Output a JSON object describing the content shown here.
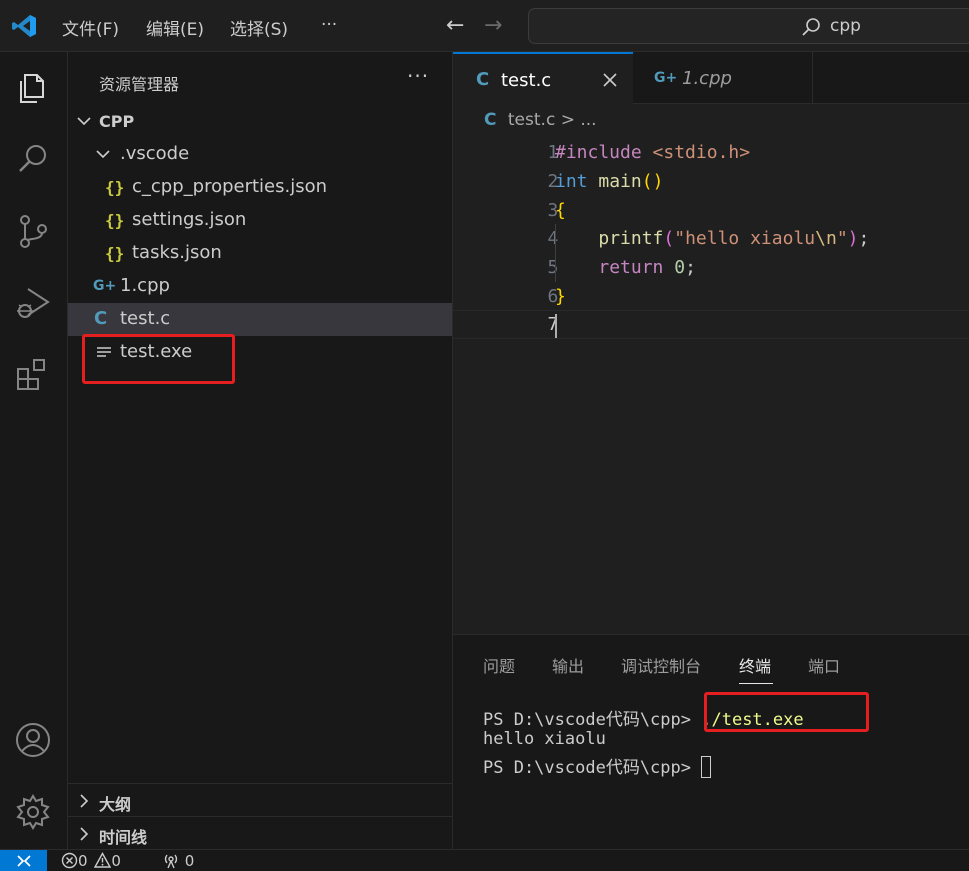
{
  "menu": {
    "file": "文件(F)",
    "edit": "编辑(E)",
    "select": "选择(S)",
    "more": "···"
  },
  "command_center": {
    "text": "cpp"
  },
  "sidebar": {
    "title": "资源管理器",
    "more": "···",
    "root": "CPP",
    "folder_vscode": ".vscode",
    "files": {
      "c_cpp_properties": "c_cpp_properties.json",
      "settings": "settings.json",
      "tasks": "tasks.json",
      "cpp1": "1.cpp",
      "testc": "test.c",
      "testexe": "test.exe"
    },
    "icons": {
      "json": "{}",
      "c": "C",
      "cpp": "G+"
    },
    "sections": {
      "outline": "大纲",
      "timeline": "时间线"
    },
    "highlight_color": "#e51f1f"
  },
  "tabs": [
    {
      "label": "test.c",
      "icon": "C",
      "active": true
    },
    {
      "label": "1.cpp",
      "icon": "G+",
      "active": false
    }
  ],
  "breadcrumb": {
    "file": "test.c",
    "rest": " > ..."
  },
  "code": {
    "line_numbers": [
      "1",
      "2",
      "3",
      "4",
      "5",
      "6",
      "7"
    ],
    "l1_directive": "#include",
    "l1_header": "<stdio.h>",
    "l2_type": "int",
    "l2_fn": "main",
    "l2_paren_open": "(",
    "l2_paren_close": ")",
    "l3_brace": "{",
    "l4_fn": "printf",
    "l4_paren_open": "(",
    "l4_str1": "\"hello xiaolu",
    "l4_esc": "\\n",
    "l4_str2": "\"",
    "l4_paren_close": ")",
    "l4_semi": ";",
    "l5_kw": "return",
    "l5_num": "0",
    "l5_semi": ";",
    "l6_brace": "}"
  },
  "panel": {
    "tabs": {
      "problems": "问题",
      "output": "输出",
      "debug_console": "调试控制台",
      "terminal": "终端",
      "ports": "端口"
    },
    "active_tab": "终端",
    "terminal": {
      "prompt1": "PS D:\\vscode代码\\cpp>",
      "command": "./test.exe",
      "output": "hello xiaolu",
      "prompt2": "PS D:\\vscode代码\\cpp>"
    }
  },
  "statusbar": {
    "errors": "0",
    "warnings": "0",
    "ports": "0"
  },
  "colors": {
    "accent": "#0078d4",
    "highlight": "#e51f1f"
  }
}
